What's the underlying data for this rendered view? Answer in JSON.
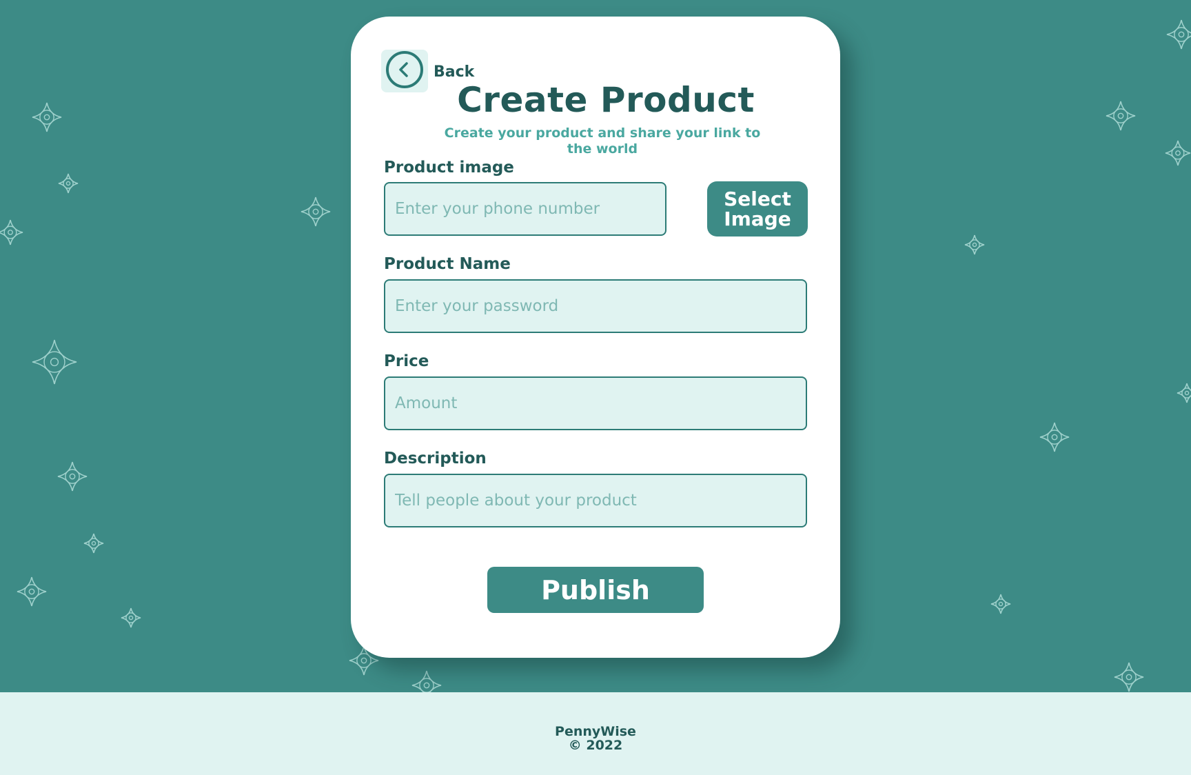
{
  "header": {
    "back_label": "Back",
    "title": "Create Product",
    "subtitle": "Create your product and share your link to the world"
  },
  "form": {
    "image": {
      "label": "Product image",
      "placeholder": "Enter your phone number",
      "value": ""
    },
    "select_image_label": "Select Image",
    "name": {
      "label": "Product Name",
      "placeholder": "Enter your password",
      "value": ""
    },
    "price": {
      "label": "Price",
      "placeholder": "Amount",
      "value": ""
    },
    "description": {
      "label": "Description",
      "placeholder": "Tell people about your product",
      "value": ""
    },
    "publish_label": "Publish"
  },
  "footer": {
    "brand": "PennyWise",
    "copyright": "© 2022"
  },
  "colors": {
    "background": "#3d8b86",
    "card": "#ffffff",
    "accent": "#3d8b86",
    "text_dark": "#235a58",
    "field_bg": "#e0f3f1",
    "subtitle": "#4aa8a0"
  },
  "icons": {
    "back": "chevron-left-circle-icon",
    "decoration": "sparkle-flower-icon"
  }
}
